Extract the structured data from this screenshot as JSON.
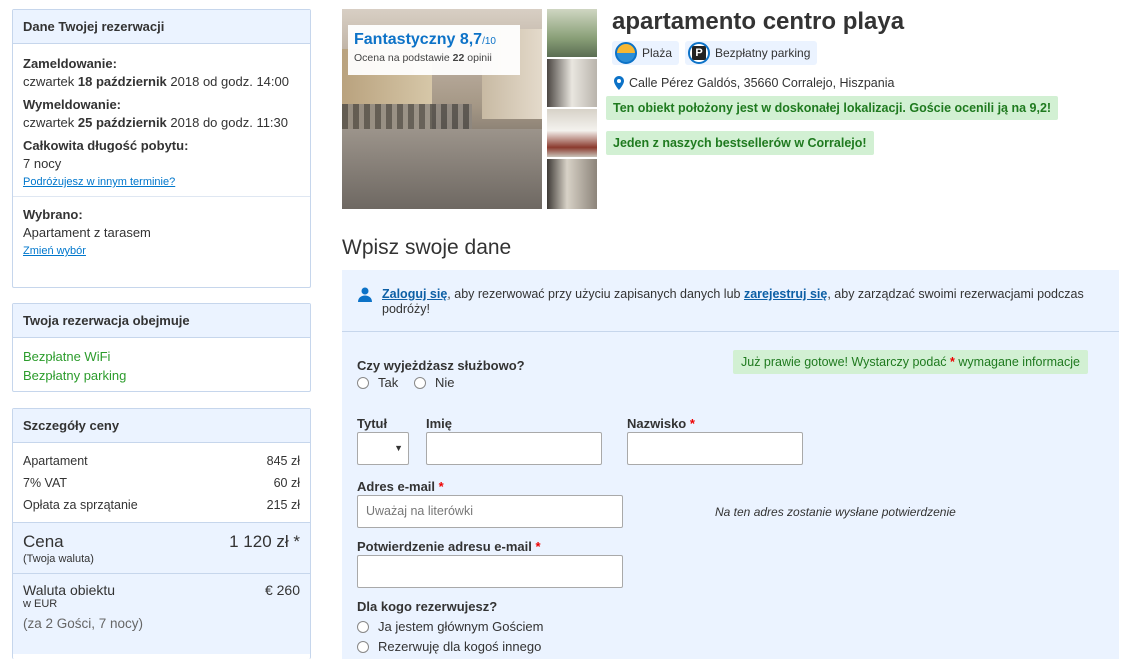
{
  "sidebar": {
    "booking_details": {
      "title": "Dane Twojej rezerwacji",
      "checkin_label": "Zameldowanie:",
      "checkin_prefix": "czwartek",
      "checkin_date": "18 październik",
      "checkin_suffix": "2018 od godz. 14:00",
      "checkout_label": "Wymeldowanie:",
      "checkout_prefix": "czwartek",
      "checkout_date": "25 październik",
      "checkout_suffix": "2018 do godz. 11:30",
      "length_label": "Całkowita długość pobytu:",
      "length_value": "7 nocy",
      "other_dates_link": "Podróżujesz w innym terminie?",
      "selected_label": "Wybrano:",
      "selected_value": "Apartament z tarasem",
      "change_link": "Zmień wybór"
    },
    "includes": {
      "title": "Twoja rezerwacja obejmuje",
      "items": [
        "Bezpłatne WiFi",
        "Bezpłatny parking"
      ]
    },
    "price": {
      "title": "Szczegóły ceny",
      "rows": [
        {
          "label": "Apartament",
          "value": "845 zł"
        },
        {
          "label": "7% VAT",
          "value": "60 zł"
        },
        {
          "label": "Opłata za sprzątanie",
          "value": "215 zł"
        }
      ],
      "total_label": "Cena",
      "total_value": "1 120 zł *",
      "total_note": "(Twoja waluta)",
      "property_currency_label": "Waluta obiektu",
      "property_currency_value": "€ 260",
      "property_currency_note": "w EUR",
      "guests_note": "(za 2 Gości, 7 nocy)"
    }
  },
  "gallery": {
    "rating_word": "Fantastyczny",
    "rating_score": "8,7",
    "rating_scale": "/10",
    "rating_sub_prefix": "Ocena na podstawie",
    "rating_count": "22",
    "rating_sub_suffix": "opinii"
  },
  "hotel": {
    "name": "apartamento centro playa",
    "facilities": [
      "Plaża",
      "Bezpłatny parking"
    ],
    "address": "Calle Pérez Galdós, 35660 Corralejo, Hiszpania",
    "highlight_location": "Ten obiekt położony jest w doskonałej lokalizacji. Goście ocenili ją na 9,2!",
    "highlight_bestseller": "Jeden z naszych bestsellerów w Corralejo!"
  },
  "form": {
    "section_title": "Wpisz swoje dane",
    "login_link": "Zaloguj się",
    "login_text_1": ", aby rezerwować przy użyciu zapisanych danych lub ",
    "register_link": "zarejestruj się",
    "login_text_2": ", aby zarządzać swoimi rezerwacjami podczas podróży!",
    "required_note_prefix": "Już prawie gotowe! Wystarczy podać",
    "required_star": "*",
    "required_note_suffix": "wymagane informacje",
    "business_question": "Czy wyjeżdżasz służbowo?",
    "business_yes": "Tak",
    "business_no": "Nie",
    "title_label": "Tytuł",
    "first_name_label": "Imię",
    "last_name_label": "Nazwisko",
    "email_label": "Adres e-mail",
    "email_placeholder": "Uważaj na literówki",
    "email_note": "Na ten adres zostanie wysłane potwierdzenie",
    "email_confirm_label": "Potwierdzenie adresu e-mail",
    "booking_for_question": "Dla kogo rezerwujesz?",
    "booking_for_self": "Ja jestem głównym Gościem",
    "booking_for_other": "Rezerwuję dla kogoś innego"
  }
}
